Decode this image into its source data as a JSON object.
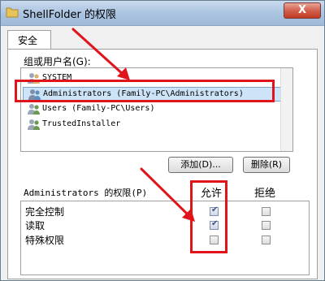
{
  "window": {
    "title": "ShellFolder 的权限",
    "close_label": "X"
  },
  "tab": {
    "label": "安全"
  },
  "groups": {
    "label": "组或用户名(G):",
    "items": [
      {
        "name": "SYSTEM",
        "selected": false
      },
      {
        "name": "Administrators (Family-PC\\Administrators)",
        "selected": true
      },
      {
        "name": "Users (Family-PC\\Users)",
        "selected": false
      },
      {
        "name": "TrustedInstaller",
        "selected": false
      }
    ]
  },
  "buttons": {
    "add": "添加(D)...",
    "remove": "删除(R)"
  },
  "permissions": {
    "label": "Administrators 的权限(P)",
    "allow_header": "允许",
    "deny_header": "拒绝",
    "rows": [
      {
        "name": "完全控制",
        "allow": true,
        "deny": false
      },
      {
        "name": "读取",
        "allow": true,
        "deny": false
      },
      {
        "name": "特殊权限",
        "allow": false,
        "deny": false
      }
    ]
  },
  "colors": {
    "highlight": "#e0141b",
    "selection": "#cde3f7",
    "titlebar": "#a9c3e0"
  }
}
